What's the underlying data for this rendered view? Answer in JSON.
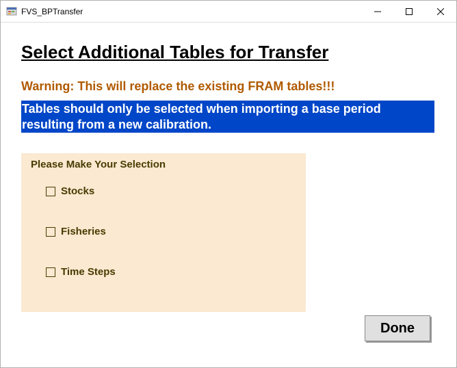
{
  "window": {
    "title": "FVS_BPTransfer"
  },
  "page": {
    "heading": "Select Additional Tables for Transfer",
    "warning": "Warning: This will replace the existing FRAM tables!!!",
    "info": "Tables should only be selected when importing a base period resulting from a new calibration."
  },
  "panel": {
    "header": "Please Make Your Selection",
    "options": [
      {
        "label": "Stocks",
        "checked": false
      },
      {
        "label": "Fisheries",
        "checked": false
      },
      {
        "label": "Time Steps",
        "checked": false
      }
    ]
  },
  "buttons": {
    "done": "Done"
  }
}
